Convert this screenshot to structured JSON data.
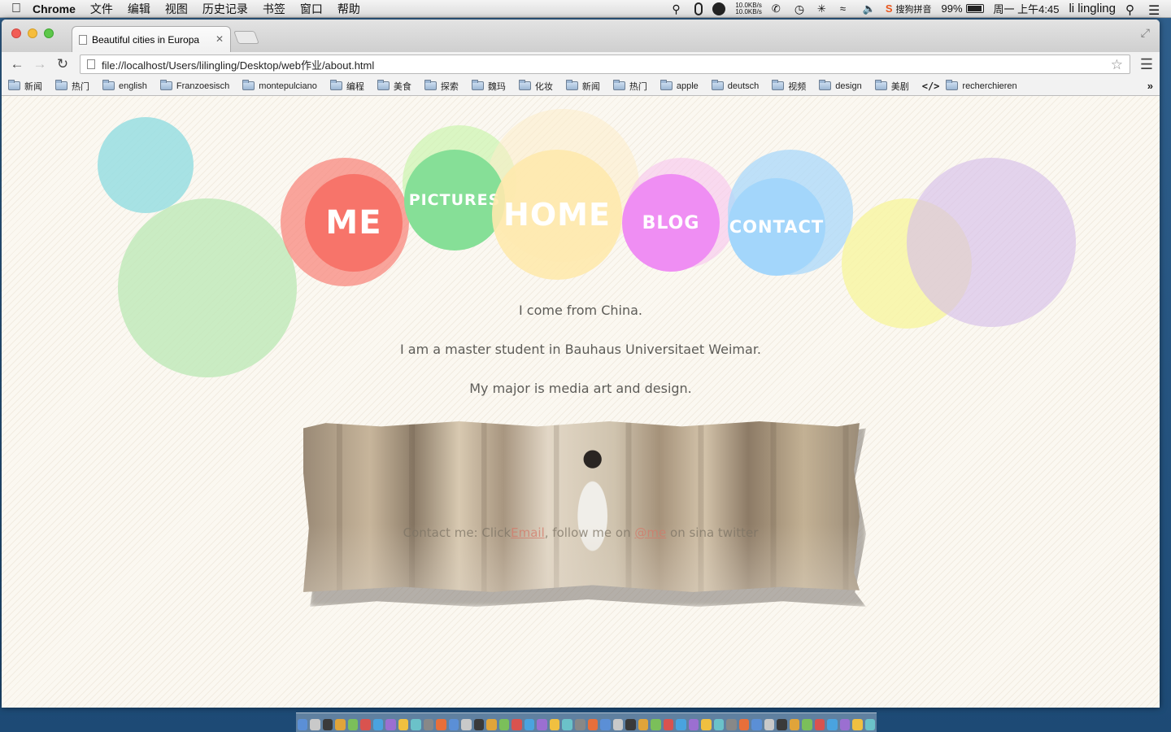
{
  "menubar": {
    "app_name": "Chrome",
    "menus": [
      "文件",
      "编辑",
      "视图",
      "历史记录",
      "书签",
      "窗口",
      "帮助"
    ],
    "net_up": "10.0KB/s",
    "net_down": "10.0KB/s",
    "input_method": "搜狗拼音",
    "battery": "99%",
    "clock": "周一 上午4:45",
    "user": "li lingling"
  },
  "browser": {
    "tab_title": "Beautiful cities in Europa",
    "url": "file://localhost/Users/lilingling/Desktop/web作业/about.html",
    "bookmarks": [
      "新闻",
      "热门",
      "english",
      "Franzoesisch",
      "montepulciano",
      "编程",
      "美食",
      "探索",
      "魏玛",
      "化妆",
      "新闻",
      "热门",
      "apple",
      "deutsch",
      "视频",
      "design",
      "美剧"
    ],
    "bookmark_last": "recherchieren"
  },
  "page": {
    "nav": {
      "me": "ME",
      "pictures": "PICTURES",
      "home": "HOME",
      "blog": "BLOG",
      "contact": "CONTACT"
    },
    "bio": [
      "I come from China.",
      "I am a master student in Bauhaus Universitaet Weimar.",
      "My major is media art and design."
    ],
    "contact": {
      "prefix": "Contact me: Click",
      "email_link": "Email",
      "middle": ", follow me on",
      "weibo_link": "@me",
      "suffix": "on sina twitter"
    }
  },
  "colors": {
    "me": "#f7776a",
    "pictures": "#88e09a",
    "home": "#fde9ad",
    "blog": "#ee90f2",
    "contact": "#a6d8fb",
    "teal": "#a6e3e6",
    "mint": "#c8ebc3",
    "yellow": "#f8f5a8",
    "lavender": "#dcc7ec"
  }
}
